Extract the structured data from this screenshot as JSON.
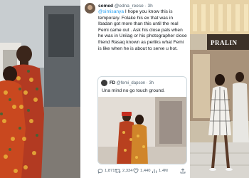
{
  "tweet": {
    "display_name": "somed",
    "handle": "@edna_reese",
    "time": "3h",
    "body_mention": "@simisanya",
    "body_text": "I hope you know this is temporary. Folake his ex that was in Ibadan got more than this until the real Femi came out . Ask his close pals when he was in Unilag or his photographer close friend Rasaq known as perliks what Femi is like when he is about to serve u hot.",
    "quote": {
      "display_name": "FD",
      "handle": "@femi_dapson",
      "time": "3h",
      "text": "Una mind no go touch ground."
    },
    "actions": {
      "replies": "1,871",
      "retweets": "2,334",
      "likes": "1,440",
      "views": "1.4M"
    }
  },
  "right_photo": {
    "store_sign": "PRALIN"
  },
  "icons": {
    "reply": "reply-icon",
    "retweet": "retweet-icon",
    "like": "heart-icon",
    "views": "views-icon",
    "share": "share-icon"
  },
  "colors": {
    "link": "#1d9bf0",
    "text": "#0f1419",
    "muted": "#536471"
  }
}
